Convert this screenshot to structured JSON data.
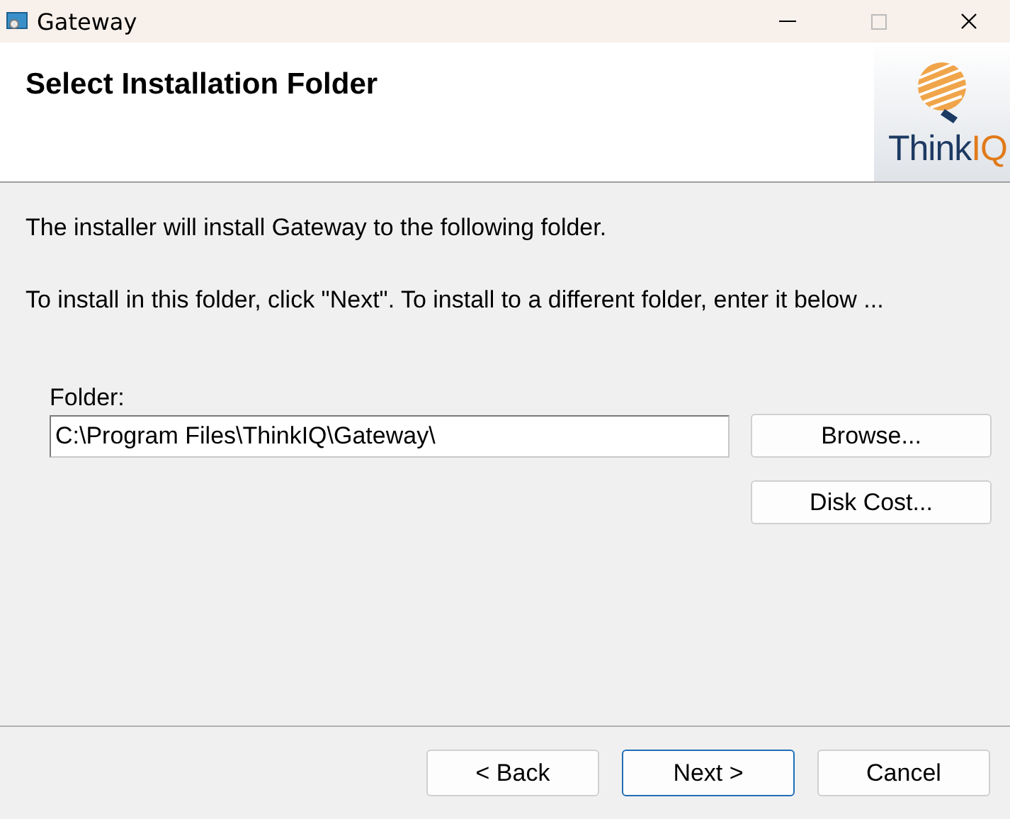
{
  "window": {
    "title": "Gateway"
  },
  "header": {
    "title": "Select Installation Folder",
    "logo_words": [
      "Think",
      "IQ"
    ]
  },
  "body": {
    "paragraphs": [
      "The installer will install Gateway to the following folder.",
      "To install in this folder, click \"Next\". To install to a different folder, enter it below ..."
    ],
    "folder_label": "Folder:",
    "folder_value": "C:\\Program Files\\ThinkIQ\\Gateway\\",
    "side_buttons": [
      "Browse...",
      "Disk Cost..."
    ]
  },
  "footer_buttons": [
    {
      "label": "< Back",
      "default": false
    },
    {
      "label": "Next >",
      "default": true
    },
    {
      "label": "Cancel",
      "default": false
    }
  ]
}
